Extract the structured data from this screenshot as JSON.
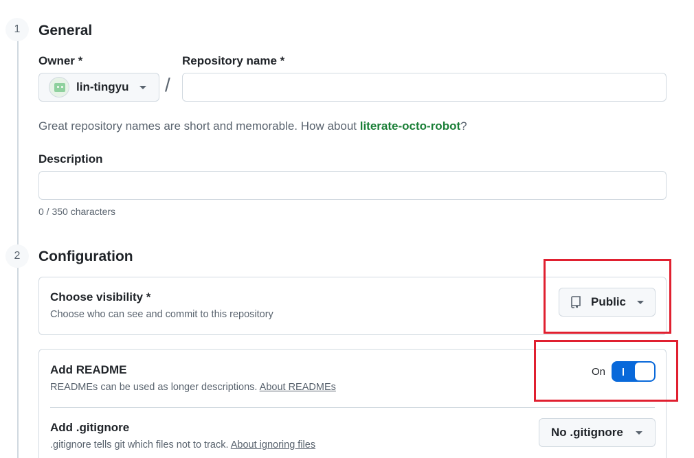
{
  "steps": [
    {
      "number": "1",
      "title": "General"
    },
    {
      "number": "2",
      "title": "Configuration"
    }
  ],
  "general": {
    "owner_label": "Owner *",
    "owner_value": "lin-tingyu",
    "slash": "/",
    "repo_name_label": "Repository name *",
    "repo_name_value": "",
    "hint_prefix": "Great repository names are short and memorable. How about ",
    "hint_suggestion": "literate-octo-robot",
    "hint_suffix": "?",
    "description_label": "Description",
    "description_value": "",
    "char_count": "0 / 350 characters"
  },
  "configuration": {
    "visibility": {
      "title": "Choose visibility *",
      "description": "Choose who can see and commit to this repository",
      "value": "Public",
      "icon": "repo-icon"
    },
    "readme": {
      "title": "Add README",
      "description": "READMEs can be used as longer descriptions. ",
      "link": "About READMEs",
      "toggle_label": "On",
      "toggle_on": true
    },
    "gitignore": {
      "title": "Add .gitignore",
      "description": ".gitignore tells git which files not to track. ",
      "link": "About ignoring files",
      "value": "No .gitignore"
    }
  },
  "colors": {
    "accent": "#0969da",
    "suggestion": "#1a7f37",
    "highlight": "#e02030"
  }
}
